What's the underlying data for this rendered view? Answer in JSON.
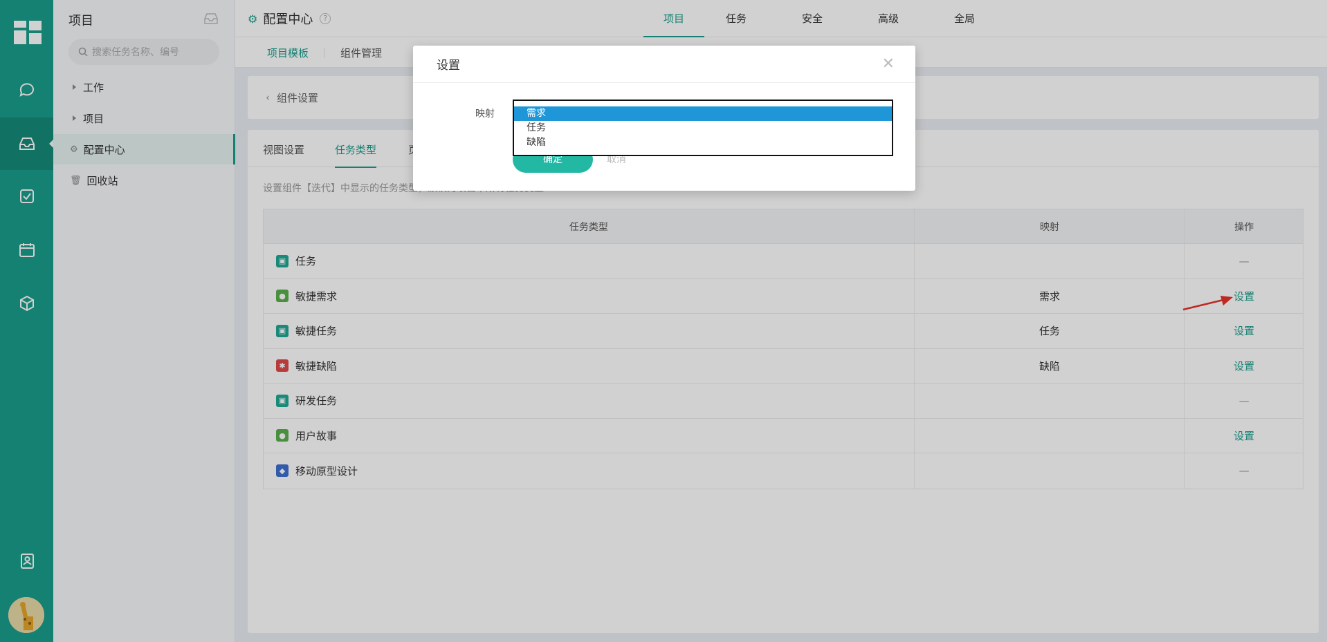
{
  "sidebar": {
    "title": "项目",
    "search_placeholder": "搜索任务名称、编号",
    "items": [
      {
        "label": "工作"
      },
      {
        "label": "项目"
      },
      {
        "label": "配置中心"
      },
      {
        "label": "回收站"
      }
    ]
  },
  "header": {
    "title": "配置中心",
    "tabs": [
      {
        "label": "项目"
      },
      {
        "label": "任务"
      },
      {
        "label": "安全"
      },
      {
        "label": "高级"
      },
      {
        "label": "全局"
      }
    ],
    "subtabs": [
      {
        "label": "项目模板"
      },
      {
        "label": "组件管理"
      }
    ]
  },
  "breadcrumb": {
    "label": "组件设置"
  },
  "panel": {
    "tabs": [
      {
        "label": "视图设置"
      },
      {
        "label": "任务类型"
      },
      {
        "label": "页"
      }
    ],
    "description": "设置组件【迭代】中显示的任务类型，默认为项目中所有任务类型",
    "table": {
      "headers": [
        "任务类型",
        "映射",
        "操作"
      ],
      "rows": [
        {
          "icon": "task-icon",
          "color": "#1fa894",
          "name": "任务",
          "mapping": "",
          "action": "—",
          "action_link": false
        },
        {
          "icon": "bulb-icon",
          "color": "#5ab04c",
          "name": "敏捷需求",
          "mapping": "需求",
          "action": "设置",
          "action_link": true
        },
        {
          "icon": "task-icon",
          "color": "#1fa894",
          "name": "敏捷任务",
          "mapping": "任务",
          "action": "设置",
          "action_link": true
        },
        {
          "icon": "bug-icon",
          "color": "#e04848",
          "name": "敏捷缺陷",
          "mapping": "缺陷",
          "action": "设置",
          "action_link": true
        },
        {
          "icon": "task-icon",
          "color": "#1fa894",
          "name": "研发任务",
          "mapping": "",
          "action": "—",
          "action_link": false
        },
        {
          "icon": "bulb-icon",
          "color": "#5ab04c",
          "name": "用户故事",
          "mapping": "",
          "action": "设置",
          "action_link": true
        },
        {
          "icon": "apple-icon",
          "color": "#3d6fd1",
          "name": "移动原型设计",
          "mapping": "",
          "action": "—",
          "action_link": false
        }
      ]
    }
  },
  "modal": {
    "title": "设置",
    "field_label": "映射",
    "options": [
      {
        "label": "需求",
        "selected": true
      },
      {
        "label": "任务",
        "selected": false
      },
      {
        "label": "缺陷",
        "selected": false
      }
    ],
    "ok_label": "确定",
    "cancel_label": "取消"
  },
  "colors": {
    "accent": "#1a9e8c",
    "selection": "#1e96d8",
    "annotation_arrow": "#e8322a"
  }
}
